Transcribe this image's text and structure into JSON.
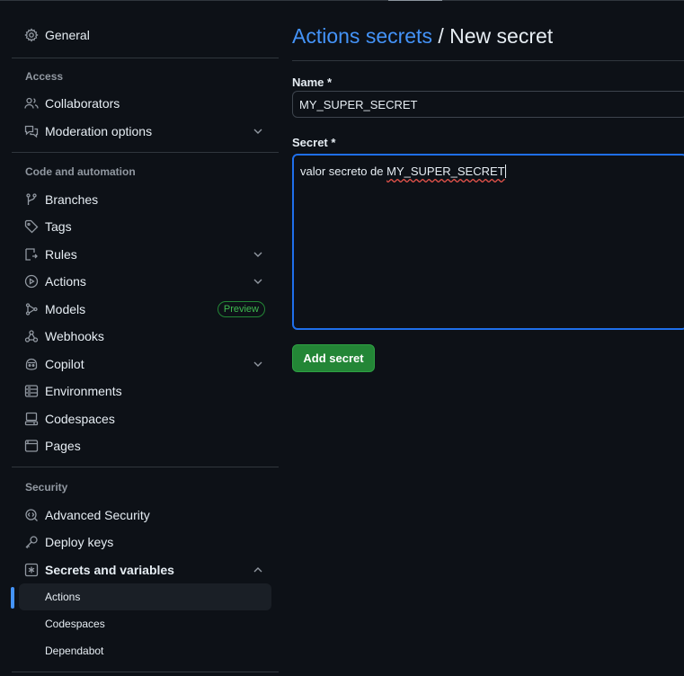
{
  "sidebar": {
    "general": "General",
    "sections": {
      "access": "Access",
      "code_automation": "Code and automation",
      "security": "Security"
    },
    "access_items": [
      {
        "label": "Collaborators",
        "icon": "people-icon"
      },
      {
        "label": "Moderation options",
        "icon": "comment-discussion-icon"
      }
    ],
    "code_items": [
      {
        "label": "Branches",
        "icon": "git-branch-icon"
      },
      {
        "label": "Tags",
        "icon": "tag-icon"
      },
      {
        "label": "Rules",
        "icon": "rules-icon"
      },
      {
        "label": "Actions",
        "icon": "play-icon"
      },
      {
        "label": "Models",
        "icon": "models-icon"
      },
      {
        "label": "Webhooks",
        "icon": "webhook-icon"
      },
      {
        "label": "Copilot",
        "icon": "copilot-icon"
      },
      {
        "label": "Environments",
        "icon": "server-icon"
      },
      {
        "label": "Codespaces",
        "icon": "codespaces-icon"
      },
      {
        "label": "Pages",
        "icon": "browser-icon"
      }
    ],
    "models_badge": "Preview",
    "security_items": [
      {
        "label": "Advanced Security",
        "icon": "codescan-icon"
      },
      {
        "label": "Deploy keys",
        "icon": "key-icon"
      },
      {
        "label": "Secrets and variables",
        "icon": "key-asterisk-icon"
      }
    ],
    "secrets_sub": [
      "Actions",
      "Codespaces",
      "Dependabot"
    ],
    "active_sub": "Actions"
  },
  "main": {
    "breadcrumb_link": "Actions secrets",
    "separator": "/",
    "current": "New secret",
    "name_label": "Name *",
    "name_value": "MY_SUPER_SECRET",
    "secret_label": "Secret *",
    "secret_value_prefix": "valor secreto de ",
    "secret_value_flagged": "MY_SUPER_SECRET",
    "submit_label": "Add secret"
  },
  "colors": {
    "background": "#0d1117",
    "accent_link": "#4493f8",
    "button_green": "#238636",
    "focus_border": "#1f6feb",
    "badge_green": "#3fb950"
  }
}
